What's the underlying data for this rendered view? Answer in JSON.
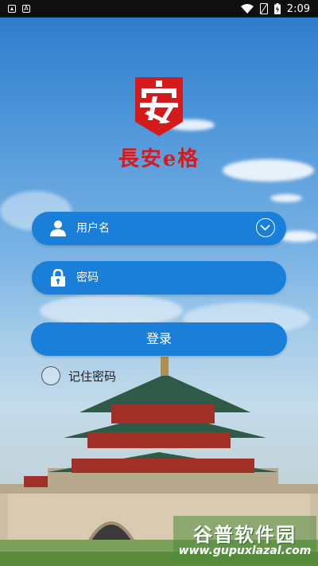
{
  "status_bar": {
    "time": "2:09",
    "left_icons": [
      "image-icon",
      "font-icon"
    ],
    "right_icons": [
      "wifi-icon",
      "sim-off-icon",
      "battery-charging-icon"
    ]
  },
  "app": {
    "brand_name": "長安e格",
    "logo_icon": "chang-an-logo",
    "brand_color": "#d41a1a",
    "accent_color": "#1a7fd9"
  },
  "form": {
    "username_label": "用户名",
    "password_label": "密码",
    "login_button": "登录",
    "remember_label": "记住密码",
    "remember_checked": false
  },
  "watermark": {
    "title": "谷普软件园",
    "url": "www.gupuxlazal.com"
  }
}
